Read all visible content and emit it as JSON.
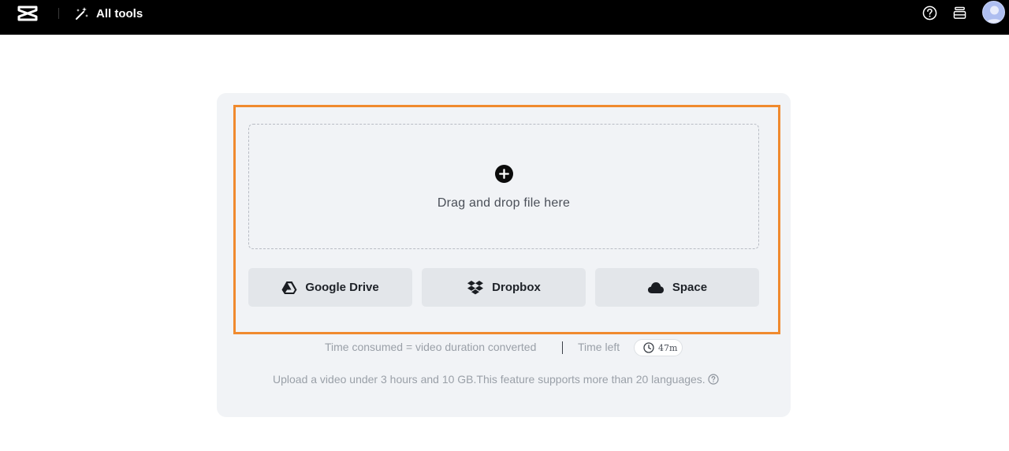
{
  "header": {
    "logo_icon": "capcut-logo-icon",
    "all_tools_label": "All tools",
    "all_tools_icon": "magic-wand-icon",
    "help_icon": "help-icon",
    "stack_icon": "layers-icon",
    "avatar_icon": "avatar-icon"
  },
  "upload": {
    "drop_text": "Drag and drop file here",
    "plus_icon": "plus-circle-icon",
    "accent_color": "#f08a2e",
    "sources": [
      {
        "label": "Google Drive",
        "icon": "google-drive-icon"
      },
      {
        "label": "Dropbox",
        "icon": "dropbox-icon"
      },
      {
        "label": "Space",
        "icon": "cloud-icon"
      }
    ]
  },
  "info": {
    "time_consumed": "Time consumed = video duration converted",
    "time_left_label": "Time left",
    "time_left_value": "47m",
    "clock_icon": "clock-icon",
    "note": "Upload a video under 3 hours and 10 GB.This feature supports more than 20 languages.",
    "note_help_icon": "help-icon"
  }
}
